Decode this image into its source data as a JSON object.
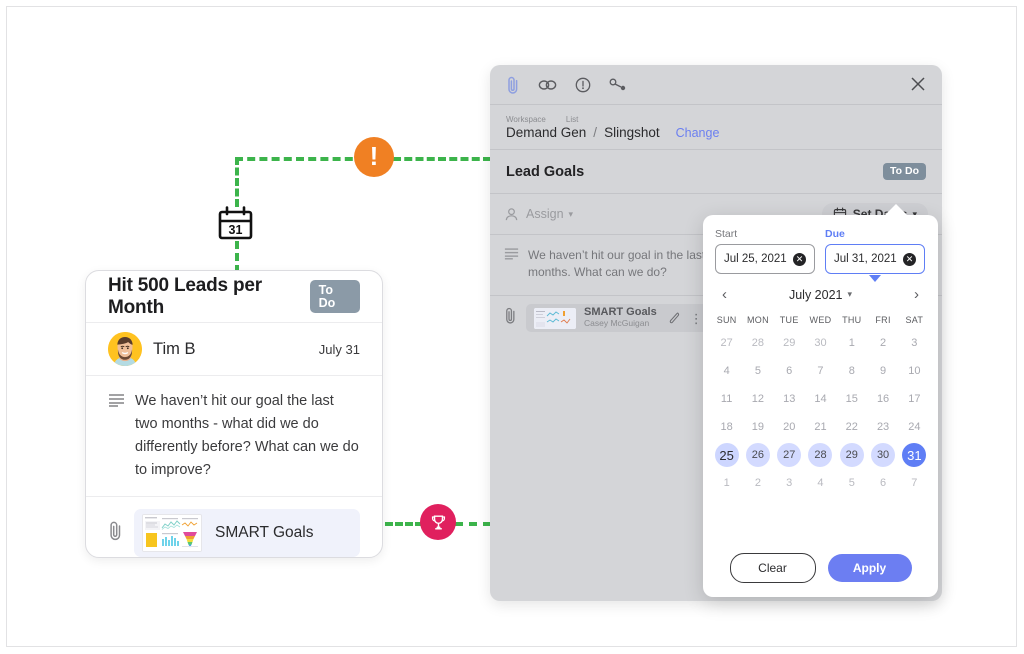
{
  "connectors": {
    "color": "#3cb44b",
    "badges": [
      {
        "name": "alert-badge",
        "glyph": "!",
        "color": "#f08023"
      },
      {
        "name": "trophy-badge",
        "glyph": "trophy-icon",
        "color": "#e0205e"
      }
    ],
    "calendar_glyph_day": "31"
  },
  "card": {
    "title": "Hit 500 Leads per Month",
    "status_badge": "To Do",
    "assignee": "Tim B",
    "date": "July 31",
    "description": "We haven’t hit our goal the last two months - what did we do differently before? What can we do to improve?",
    "attachment": {
      "label": "SMART Goals",
      "icon": "paperclip-icon",
      "thumb": "dashboard-thumbnail"
    },
    "description_icon": "description-lines-icon"
  },
  "modal": {
    "toolbar_icons": [
      "attachment-icon",
      "link-icon",
      "alert-circle-icon",
      "relationship-icon"
    ],
    "close_icon": "close-icon",
    "breadcrumb": {
      "workspace_label": "Workspace",
      "workspace_value": "Demand Gen",
      "separator": "/",
      "list_label": "List",
      "list_value": "Slingshot",
      "change_link": "Change"
    },
    "title": "Lead Goals",
    "status_badge": "To Do",
    "assign_label": "Assign",
    "assign_icon": "person-icon",
    "set_dates_label": "Set Dates",
    "set_dates_icon": "calendar-icon",
    "description": "We haven’t hit our goal in the last two months. What can we do?",
    "attachment": {
      "title": "SMART Goals",
      "subtitle": "Casey McGuigan",
      "edit_icon": "pen-icon",
      "more_icon": "more-vertical-icon",
      "clip_icon": "paperclip-icon"
    }
  },
  "date_popup": {
    "start": {
      "label": "Start",
      "value": "Jul 25, 2021",
      "clear_icon": "clear-circle-icon"
    },
    "due": {
      "label": "Due",
      "value": "Jul 31, 2021",
      "clear_icon": "clear-circle-icon"
    },
    "prev_icon": "chevron-left-icon",
    "next_icon": "chevron-right-icon",
    "month_label": "July 2021",
    "month_caret": "chevron-down-icon",
    "weekdays": [
      "SUN",
      "MON",
      "TUE",
      "WED",
      "THU",
      "FRI",
      "SAT"
    ],
    "weeks": [
      [
        {
          "d": "27",
          "m": "prev"
        },
        {
          "d": "28",
          "m": "prev"
        },
        {
          "d": "29",
          "m": "prev"
        },
        {
          "d": "30",
          "m": "prev"
        },
        {
          "d": "1",
          "m": "cur"
        },
        {
          "d": "2",
          "m": "cur"
        },
        {
          "d": "3",
          "m": "cur"
        }
      ],
      [
        {
          "d": "4",
          "m": "cur"
        },
        {
          "d": "5",
          "m": "cur"
        },
        {
          "d": "6",
          "m": "cur"
        },
        {
          "d": "7",
          "m": "cur"
        },
        {
          "d": "8",
          "m": "cur"
        },
        {
          "d": "9",
          "m": "cur"
        },
        {
          "d": "10",
          "m": "cur"
        }
      ],
      [
        {
          "d": "11",
          "m": "cur"
        },
        {
          "d": "12",
          "m": "cur"
        },
        {
          "d": "13",
          "m": "cur"
        },
        {
          "d": "14",
          "m": "cur"
        },
        {
          "d": "15",
          "m": "cur"
        },
        {
          "d": "16",
          "m": "cur"
        },
        {
          "d": "17",
          "m": "cur"
        }
      ],
      [
        {
          "d": "18",
          "m": "cur"
        },
        {
          "d": "19",
          "m": "cur"
        },
        {
          "d": "20",
          "m": "cur"
        },
        {
          "d": "21",
          "m": "cur"
        },
        {
          "d": "22",
          "m": "cur"
        },
        {
          "d": "23",
          "m": "cur"
        },
        {
          "d": "24",
          "m": "cur"
        }
      ],
      [
        {
          "d": "25",
          "m": "cur",
          "sel": "start"
        },
        {
          "d": "26",
          "m": "cur",
          "sel": "mid"
        },
        {
          "d": "27",
          "m": "cur",
          "sel": "mid"
        },
        {
          "d": "28",
          "m": "cur",
          "sel": "mid"
        },
        {
          "d": "29",
          "m": "cur",
          "sel": "mid"
        },
        {
          "d": "30",
          "m": "cur",
          "sel": "mid"
        },
        {
          "d": "31",
          "m": "cur",
          "sel": "end"
        }
      ],
      [
        {
          "d": "1",
          "m": "next"
        },
        {
          "d": "2",
          "m": "next"
        },
        {
          "d": "3",
          "m": "next"
        },
        {
          "d": "4",
          "m": "next"
        },
        {
          "d": "5",
          "m": "next"
        },
        {
          "d": "6",
          "m": "next"
        },
        {
          "d": "7",
          "m": "next"
        }
      ]
    ],
    "clear_button": "Clear",
    "apply_button": "Apply",
    "accent": "#5f7ef5",
    "range_fill": "#d3daff"
  }
}
